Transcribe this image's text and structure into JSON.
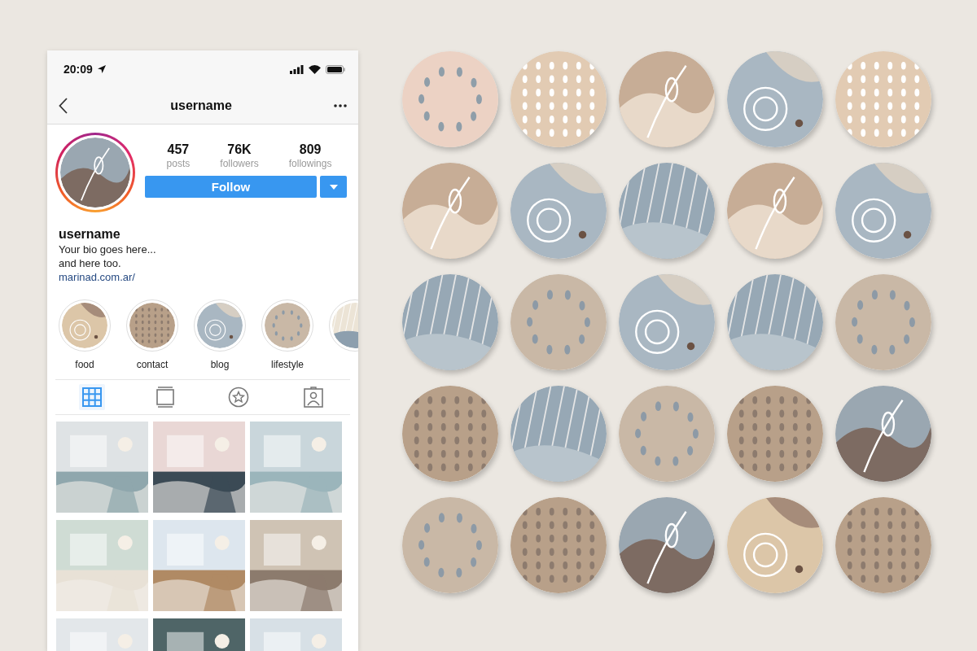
{
  "status_bar": {
    "time": "20:09"
  },
  "nav_bar": {
    "title": "username"
  },
  "profile": {
    "avatar": {
      "kind": "picture"
    },
    "stats": [
      {
        "value": "457",
        "label": "posts"
      },
      {
        "value": "76K",
        "label": "followers"
      },
      {
        "value": "809",
        "label": "followings"
      }
    ],
    "follow_button": "Follow",
    "name": "username",
    "bio": [
      "Your bio goes here...",
      "and here too."
    ],
    "link": "marinad.com.ar/"
  },
  "highlights": [
    {
      "kind": "picture",
      "label": "food"
    },
    {
      "kind": "picture",
      "label": "contact"
    },
    {
      "kind": "picture",
      "label": "blog"
    },
    {
      "kind": "picture",
      "label": "lifestyle"
    },
    {
      "kind": "picture"
    }
  ],
  "tabs": [
    {
      "kind": "grid",
      "selected": true
    },
    {
      "kind": "feed",
      "selected": false
    },
    {
      "kind": "star",
      "selected": false
    },
    {
      "kind": "tagged",
      "selected": false
    }
  ],
  "posts": [
    {
      "kind": "picture"
    },
    {
      "kind": "picture"
    },
    {
      "kind": "picture"
    },
    {
      "kind": "picture"
    },
    {
      "kind": "picture"
    },
    {
      "kind": "picture"
    },
    {
      "kind": "picture"
    },
    {
      "kind": "picture"
    },
    {
      "kind": "picture"
    }
  ],
  "highlight_covers": [
    {
      "kind": "picture"
    },
    {
      "kind": "picture"
    },
    {
      "kind": "picture"
    },
    {
      "kind": "picture"
    },
    {
      "kind": "picture"
    },
    {
      "kind": "picture"
    },
    {
      "kind": "picture"
    },
    {
      "kind": "picture"
    },
    {
      "kind": "picture"
    },
    {
      "kind": "picture"
    },
    {
      "kind": "picture"
    },
    {
      "kind": "picture"
    },
    {
      "kind": "picture"
    },
    {
      "kind": "picture"
    },
    {
      "kind": "picture"
    },
    {
      "kind": "picture"
    },
    {
      "kind": "picture"
    },
    {
      "kind": "picture"
    },
    {
      "kind": "picture"
    },
    {
      "kind": "picture"
    },
    {
      "kind": "picture"
    },
    {
      "kind": "picture"
    },
    {
      "kind": "picture"
    },
    {
      "kind": "picture"
    },
    {
      "kind": "picture"
    }
  ]
}
